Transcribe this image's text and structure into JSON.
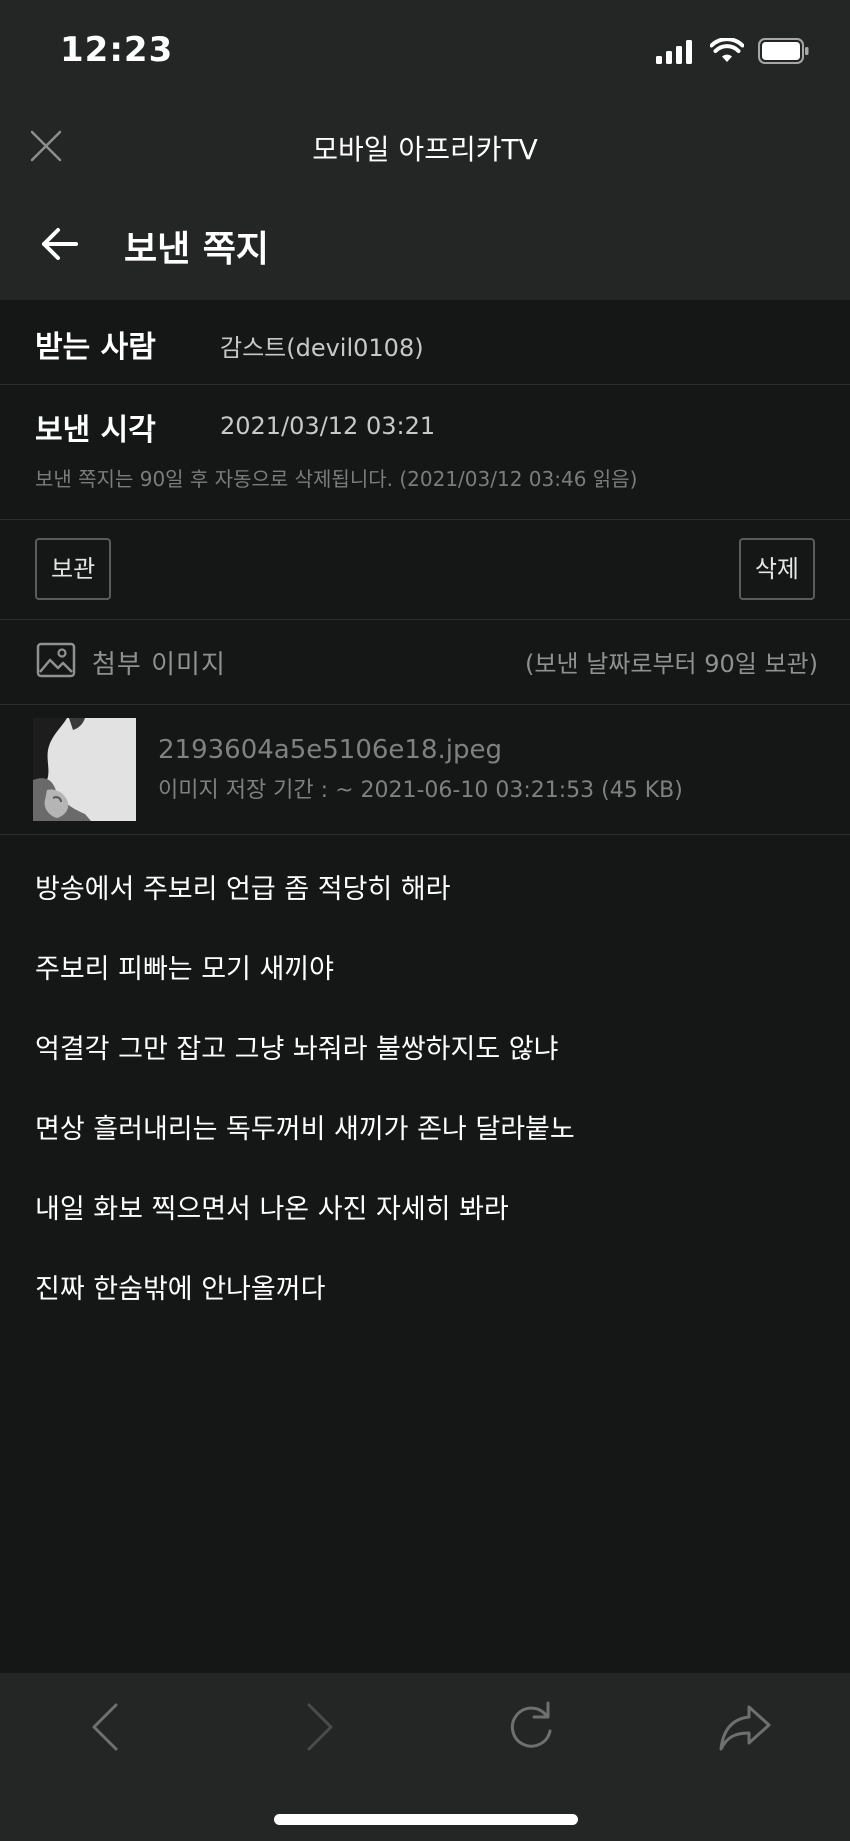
{
  "status_bar": {
    "time": "12:23",
    "icons": [
      "signal-icon",
      "wifi-icon",
      "battery-icon"
    ]
  },
  "browser": {
    "title": "모바일 아프리카TV",
    "close_icon": "close-icon"
  },
  "header": {
    "title": "보낸 쪽지",
    "back_icon": "arrow-left-icon"
  },
  "recipient": {
    "label": "받는 사람",
    "value": "감스트(devil0108)"
  },
  "sent_time": {
    "label": "보낸 시각",
    "value": "2021/03/12 03:21",
    "notice": "보낸 쪽지는 90일 후 자동으로 삭제됩니다. (2021/03/12 03:46 읽음)"
  },
  "actions": {
    "archive_label": "보관",
    "delete_label": "삭제"
  },
  "attachment": {
    "icon": "image-icon",
    "label": "첨부 이미지",
    "retention": "(보낸 날짜로부터 90일 보관)",
    "file_name": "2193604a5e5106e18.jpeg",
    "file_meta": "이미지 저장 기간 : ~ 2021-06-10 03:21:53 (45 KB)"
  },
  "message_lines": [
    "방송에서 주보리 언급 좀 적당히 해라",
    "주보리 피빠는 모기 새끼야",
    "억결각 그만 잡고 그냥 놔줘라 불쌍하지도 않냐",
    "면상 흘러내리는 독두꺼비 새끼가 존나 달라붙노",
    "내일 화보 찍으면서 나온 사진 자세히 봐라",
    "진짜 한숨밖에 안나올꺼다"
  ],
  "toolbar": {
    "icons": [
      "chevron-left-icon",
      "chevron-right-icon",
      "reload-icon",
      "share-icon"
    ]
  },
  "colors": {
    "background": "#151616",
    "header_background": "#242525",
    "muted_text": "#7b7c7c",
    "divider": "#2c2d2d"
  }
}
